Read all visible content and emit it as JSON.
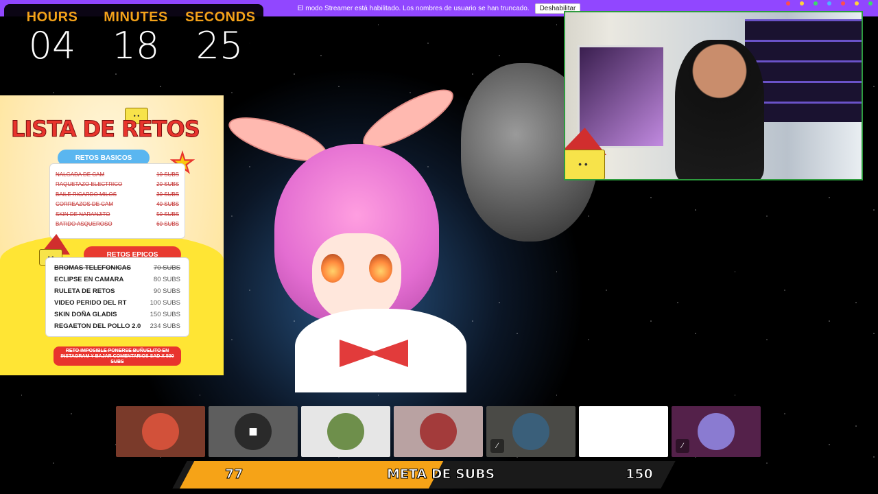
{
  "banner": {
    "message": "El modo Streamer está habilitado. Los nombres de usuario se han truncado.",
    "button_label": "Deshabilitar"
  },
  "timer": {
    "hours_label": "HOURS",
    "minutes_label": "MINUTES",
    "seconds_label": "SECONDS",
    "hours": "04",
    "minutes": "18",
    "seconds": "25"
  },
  "retos": {
    "title": "LISTA DE RETOS",
    "basic_label": "RETOS BASICOS",
    "basic": [
      {
        "name": "NALGADA DE CAM",
        "subs": "10 SUBS"
      },
      {
        "name": "RAQUETAZO ELECTRICO",
        "subs": "20 SUBS"
      },
      {
        "name": "BAILE RICARDO MILOS",
        "subs": "30 SUBS"
      },
      {
        "name": "CORREAZOS DE CAM",
        "subs": "40 SUBS"
      },
      {
        "name": "SKIN DE NARANJITO",
        "subs": "50 SUBS"
      },
      {
        "name": "BATIDO ASQUEROSO",
        "subs": "60 SUBS"
      }
    ],
    "epic_label": "RETOS EPICOS",
    "epic": [
      {
        "name": "BROMAS  TELEFONICAS",
        "subs": "70 SUBS"
      },
      {
        "name": "ECLIPSE EN CAMARA",
        "subs": "80 SUBS"
      },
      {
        "name": "RULETA DE RETOS",
        "subs": "90 SUBS"
      },
      {
        "name": "VIDEO PERIDO DEL RT",
        "subs": "100 SUBS"
      },
      {
        "name": "SKIN DOÑA GLADIS",
        "subs": "150 SUBS"
      },
      {
        "name": "REGAETON DEL POLLO 2.0",
        "subs": "234 SUBS"
      }
    ],
    "impossible": "RETO IMPOSIBLE PONERSE BUÑUELITO EN INSTAGRAM Y BAJAR COMENTARIOS SAD X 500 SUBS"
  },
  "viewers": [
    {
      "bg": "#7a3a2a",
      "avatar": "#d2513a",
      "muted": false
    },
    {
      "bg": "#5e5e5e",
      "avatar": "#2a2a2a",
      "muted": false,
      "icon": "camera-icon"
    },
    {
      "bg": "#e6e6e6",
      "avatar": "#6e8f4b",
      "muted": false
    },
    {
      "bg": "#b9a2a2",
      "avatar": "#a33b3b",
      "muted": false
    },
    {
      "bg": "#4a4a46",
      "avatar": "#3a5f7a",
      "muted": true
    },
    {
      "bg": "#ffffff",
      "avatar": "#ffffff",
      "muted": false
    },
    {
      "bg": "#54214a",
      "avatar": "#8a7bd1",
      "muted": true
    }
  ],
  "goal": {
    "current": "77",
    "label": "META DE SUBS",
    "target": "150",
    "progress": 0.51
  },
  "colors": {
    "accent": "#9147ff",
    "timer_label": "#f4a21a",
    "goal_fill": "#f6a317",
    "cam_border": "#2e9b3e"
  }
}
